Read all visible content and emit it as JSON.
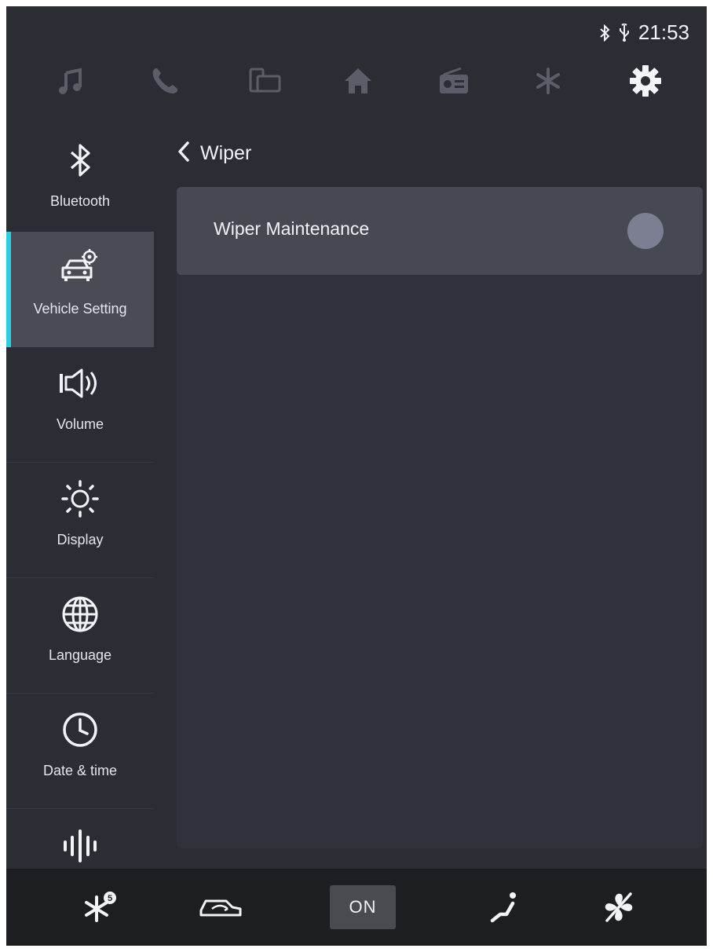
{
  "status_bar": {
    "time": "21:53",
    "icons": [
      "bluetooth-icon",
      "usb-icon"
    ]
  },
  "top_nav": {
    "items": [
      {
        "icon": "music-icon",
        "active": false
      },
      {
        "icon": "phone-icon",
        "active": false
      },
      {
        "icon": "mirror-screen-icon",
        "active": false
      },
      {
        "icon": "home-icon",
        "active": false
      },
      {
        "icon": "radio-icon",
        "active": false
      },
      {
        "icon": "snowflake-icon",
        "active": false
      },
      {
        "icon": "gear-icon",
        "active": true
      }
    ]
  },
  "sidebar": {
    "items": [
      {
        "label": "Bluetooth",
        "icon": "bluetooth-icon",
        "active": false
      },
      {
        "label": "Vehicle Setting",
        "icon": "vehicle-setting-icon",
        "active": true
      },
      {
        "label": "Volume",
        "icon": "volume-icon",
        "active": false
      },
      {
        "label": "Display",
        "icon": "brightness-icon",
        "active": false
      },
      {
        "label": "Language",
        "icon": "globe-icon",
        "active": false
      },
      {
        "label": "Date & time",
        "icon": "clock-icon",
        "active": false
      },
      {
        "label": "",
        "icon": "sound-wave-icon",
        "active": false
      }
    ]
  },
  "main": {
    "title": "Wiper",
    "settings": [
      {
        "label": "Wiper Maintenance",
        "enabled": false
      }
    ]
  },
  "bottom_bar": {
    "items": [
      {
        "icon": "ac-level-icon",
        "badge": "5"
      },
      {
        "icon": "air-recirculation-icon"
      },
      {
        "label": "ON",
        "icon": ""
      },
      {
        "icon": "seat-airflow-icon"
      },
      {
        "icon": "fan-off-icon"
      }
    ]
  },
  "colors": {
    "background": "#2b2d35",
    "accent": "#2bd0e0",
    "row": "#474952",
    "toggle_knob": "#7c7f92",
    "bottom_bar": "#1d1e22"
  }
}
